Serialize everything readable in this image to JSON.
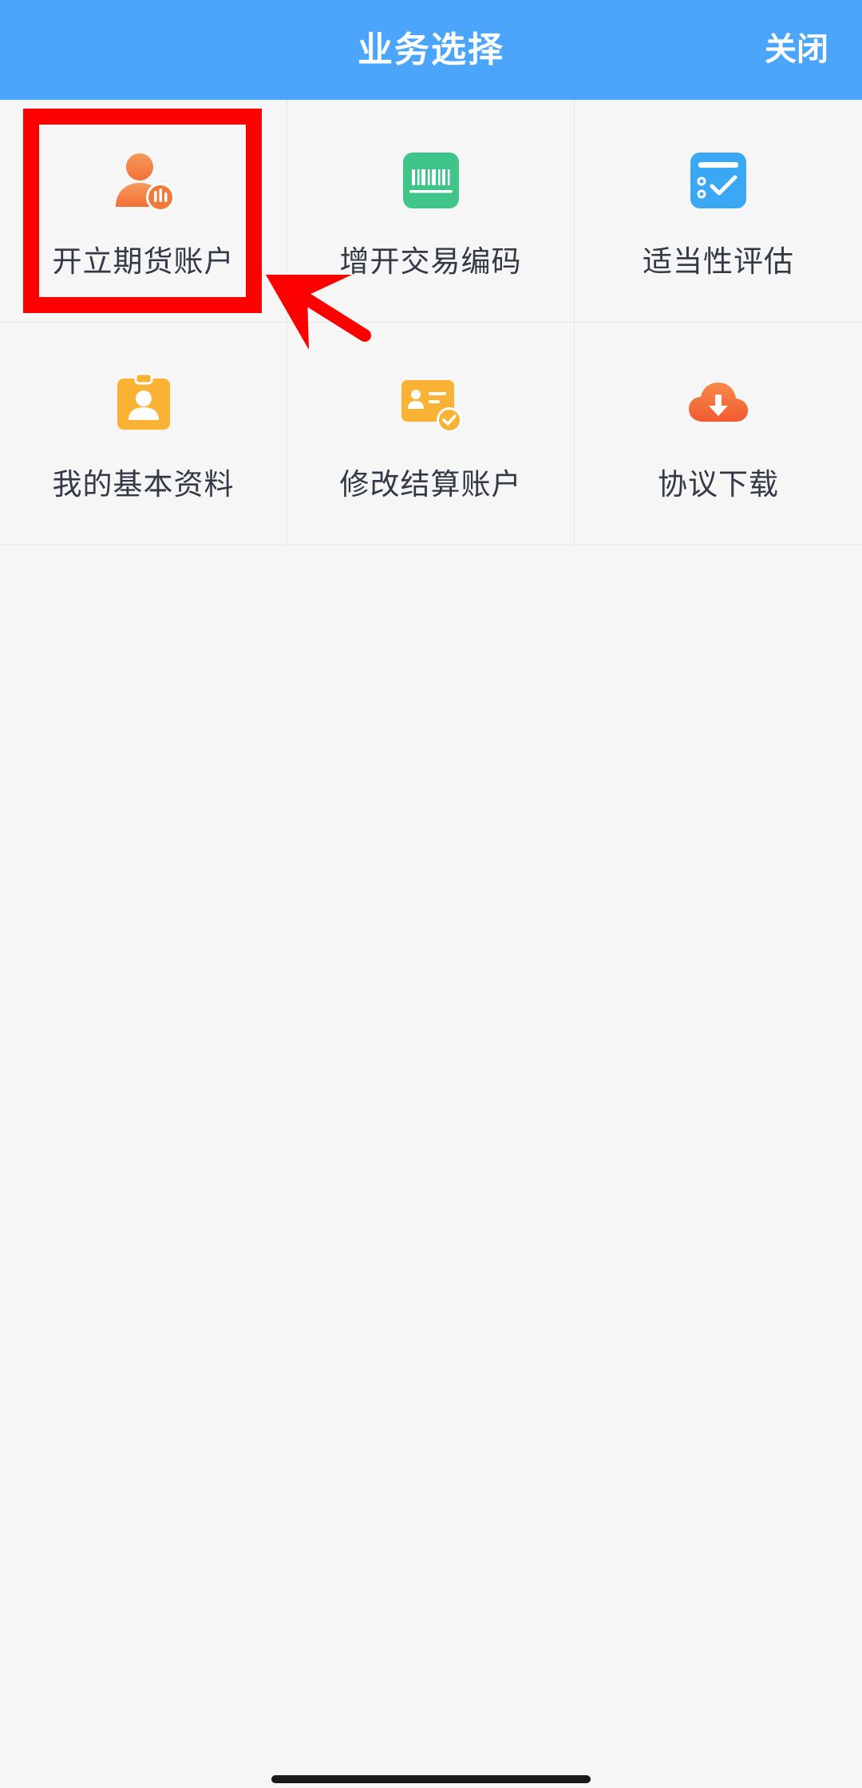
{
  "header": {
    "title": "业务选择",
    "close_label": "关闭"
  },
  "menu": {
    "items": [
      {
        "label": "开立期货账户",
        "icon": "user-open-account-icon",
        "color": "#f47a3c"
      },
      {
        "label": "增开交易编码",
        "icon": "barcode-icon",
        "color": "#3fc48a"
      },
      {
        "label": "适当性评估",
        "icon": "checklist-icon",
        "color": "#3ba8f5"
      },
      {
        "label": "我的基本资料",
        "icon": "id-badge-icon",
        "color": "#f9b233"
      },
      {
        "label": "修改结算账户",
        "icon": "id-card-check-icon",
        "color": "#f9b233"
      },
      {
        "label": "协议下载",
        "icon": "cloud-download-icon",
        "color": "#f66a3c"
      }
    ]
  },
  "colors": {
    "header_bg": "#4ba6fb",
    "annotation": "#ff0000"
  }
}
